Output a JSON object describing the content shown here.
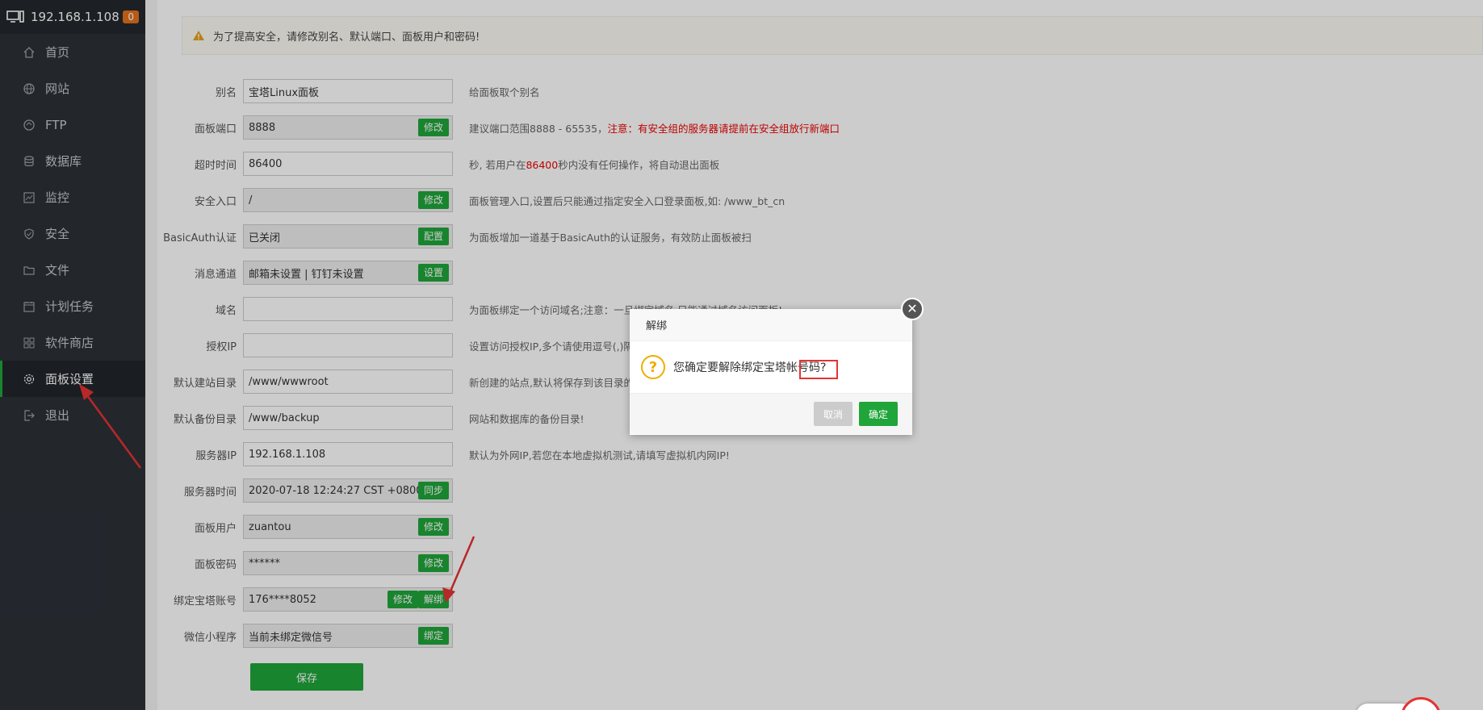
{
  "sidebar": {
    "ip": "192.168.1.108",
    "badge": "0",
    "items": [
      {
        "label": "首页",
        "icon": "home-icon"
      },
      {
        "label": "网站",
        "icon": "globe-icon"
      },
      {
        "label": "FTP",
        "icon": "ftp-icon"
      },
      {
        "label": "数据库",
        "icon": "database-icon"
      },
      {
        "label": "监控",
        "icon": "monitor-icon"
      },
      {
        "label": "安全",
        "icon": "shield-icon"
      },
      {
        "label": "文件",
        "icon": "folder-icon"
      },
      {
        "label": "计划任务",
        "icon": "calendar-icon"
      },
      {
        "label": "软件商店",
        "icon": "apps-icon"
      },
      {
        "label": "面板设置",
        "icon": "gear-icon",
        "active": true
      },
      {
        "label": "退出",
        "icon": "logout-icon"
      }
    ]
  },
  "alert": {
    "text": "为了提高安全，请修改别名、默认端口、面板用户和密码!"
  },
  "form": {
    "alias": {
      "label": "别名",
      "value": "宝塔Linux面板",
      "hint": "给面板取个别名"
    },
    "port": {
      "label": "面板端口",
      "value": "8888",
      "button": "修改",
      "hint": "建议端口范围8888 - 65535，",
      "hint_red": "注意：有安全组的服务器请提前在安全组放行新端口"
    },
    "timeout": {
      "label": "超时时间",
      "value": "86400",
      "hint_a": "秒, 若用户在",
      "hint_red": "86400",
      "hint_b": "秒内没有任何操作，将自动退出面板"
    },
    "entry": {
      "label": "安全入口",
      "value": "/",
      "button": "修改",
      "hint": "面板管理入口,设置后只能通过指定安全入口登录面板,如: /www_bt_cn"
    },
    "basicauth": {
      "label": "BasicAuth认证",
      "value": "已关闭",
      "button": "配置",
      "hint": "为面板增加一道基于BasicAuth的认证服务，有效防止面板被扫"
    },
    "message": {
      "label": "消息通道",
      "value": "邮箱未设置 | 钉钉未设置",
      "button": "设置"
    },
    "domain": {
      "label": "域名",
      "value": "",
      "hint": "为面板绑定一个访问域名;注意：一旦绑定域名,只能通过域名访问面板!"
    },
    "auth_ip": {
      "label": "授权IP",
      "value": "",
      "hint": "设置访问授权IP,多个请使用逗号(,)隔开"
    },
    "site_dir": {
      "label": "默认建站目录",
      "value": "/www/wwwroot",
      "hint": "新创建的站点,默认将保存到该目录的下级目录!"
    },
    "backup_dir": {
      "label": "默认备份目录",
      "value": "/www/backup",
      "hint": "网站和数据库的备份目录!"
    },
    "server_ip": {
      "label": "服务器IP",
      "value": "192.168.1.108",
      "hint": "默认为外网IP,若您在本地虚拟机测试,请填写虚拟机内网IP!"
    },
    "server_time": {
      "label": "服务器时间",
      "value": "2020-07-18 12:24:27 CST +0800",
      "button": "同步"
    },
    "panel_user": {
      "label": "面板用户",
      "value": "zuantou",
      "button": "修改"
    },
    "panel_pwd": {
      "label": "面板密码",
      "value": "******",
      "button": "修改"
    },
    "bt_account": {
      "label": "绑定宝塔账号",
      "value": "176****8052",
      "button1": "修改",
      "button2": "解绑"
    },
    "wechat": {
      "label": "微信小程序",
      "value": "当前未绑定微信号",
      "button": "绑定"
    },
    "save": "保存"
  },
  "modal": {
    "title": "解绑",
    "message": "您确定要解除绑定宝塔帐号码?",
    "cancel": "取消",
    "ok": "确定",
    "close": "✕",
    "q": "?"
  },
  "colors": {
    "accent": "#20a53a",
    "sidebar": "#2c3138",
    "annotation": "#e53333"
  }
}
